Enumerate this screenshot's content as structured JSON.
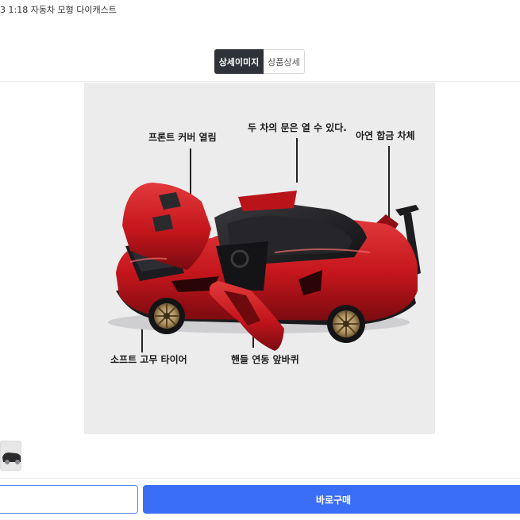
{
  "product": {
    "title": "3 1:18 자동차 모형 다이캐스트"
  },
  "tabs": [
    {
      "label": "상세이미지",
      "active": true
    },
    {
      "label": "상품상세",
      "active": false
    }
  ],
  "detail_image": {
    "callouts": {
      "front_cover": "프론트 커버 열림",
      "doors": "두 차의 문은 열 수 있다.",
      "body": "아연 합금 차체",
      "tires": "소프트 고무 타이어",
      "steering": "핸들 연동 앞바퀴"
    }
  },
  "bottom_bar": {
    "buy_label": "바로구매"
  },
  "colors": {
    "accent": "#3b6ef6",
    "tab_active_bg": "#2f3238",
    "car_red": "#c4161c"
  }
}
